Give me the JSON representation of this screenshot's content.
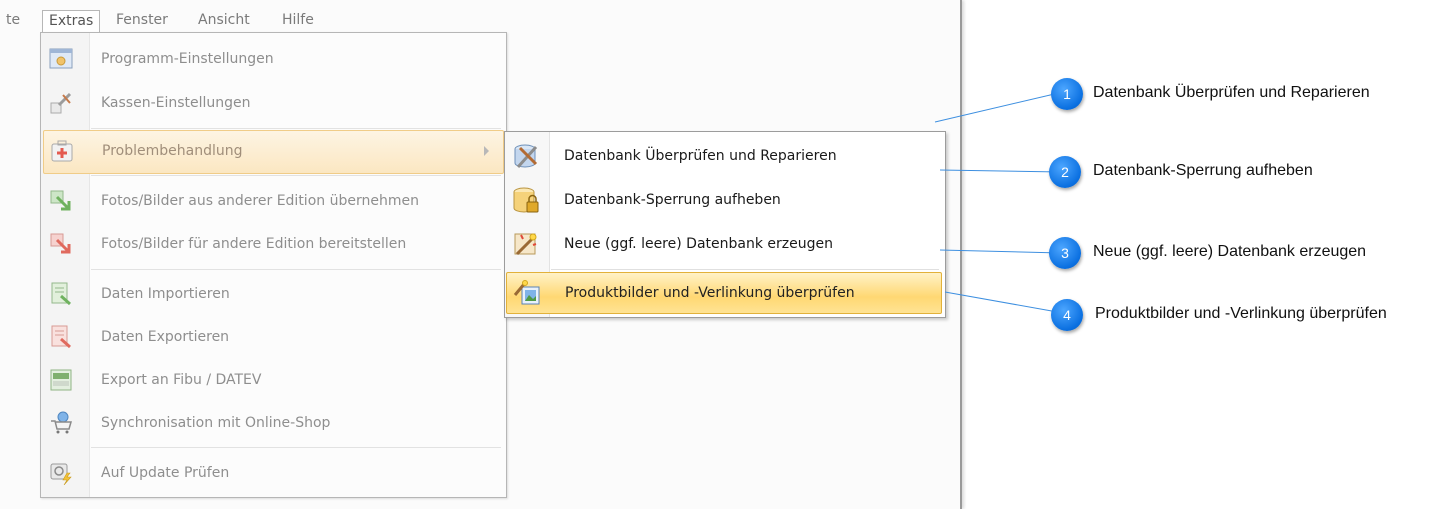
{
  "menubar": {
    "items": [
      {
        "label": "te"
      },
      {
        "label": "Extras"
      },
      {
        "label": "Fenster"
      },
      {
        "label": "Ansicht"
      },
      {
        "label": "Hilfe"
      }
    ]
  },
  "extras_menu": {
    "items": [
      {
        "label": "Programm-Einstellungen",
        "icon": "settings-window-icon"
      },
      {
        "label": "Kassen-Einstellungen",
        "icon": "tools-icon"
      },
      {
        "label": "Problembehandlung",
        "icon": "first-aid-icon"
      },
      {
        "label": "Fotos/Bilder aus anderer Edition übernehmen",
        "icon": "import-arrow-icon"
      },
      {
        "label": "Fotos/Bilder für andere Edition bereitstellen",
        "icon": "export-arrow-icon"
      },
      {
        "label": "Daten Importieren",
        "icon": "data-import-icon"
      },
      {
        "label": "Daten Exportieren",
        "icon": "data-export-icon"
      },
      {
        "label": "Export an Fibu / DATEV",
        "icon": "datev-icon"
      },
      {
        "label": "Synchronisation mit Online-Shop",
        "icon": "shopping-cart-icon"
      },
      {
        "label": "Auf Update Prüfen",
        "icon": "update-icon"
      }
    ]
  },
  "submenu": {
    "items": [
      {
        "label": "Datenbank Überprüfen und Reparieren",
        "icon": "database-repair-icon"
      },
      {
        "label": "Datenbank-Sperrung aufheben",
        "icon": "database-lock-icon"
      },
      {
        "label": "Neue (ggf. leere) Datenbank erzeugen",
        "icon": "new-database-icon"
      },
      {
        "label": "Produktbilder und -Verlinkung überprüfen",
        "icon": "product-images-icon"
      }
    ]
  },
  "callouts": [
    {
      "number": "1",
      "text": "Datenbank Überprüfen und Reparieren"
    },
    {
      "number": "2",
      "text": "Datenbank-Sperrung aufheben"
    },
    {
      "number": "3",
      "text": "Neue (ggf. leere) Datenbank erzeugen"
    },
    {
      "number": "4",
      "text": "Produktbilder und -Verlinkung überprüfen"
    }
  ],
  "colors": {
    "badge": "#0a6fe0",
    "leader_line": "#3d8fe0",
    "highlight": "#ffd873"
  }
}
